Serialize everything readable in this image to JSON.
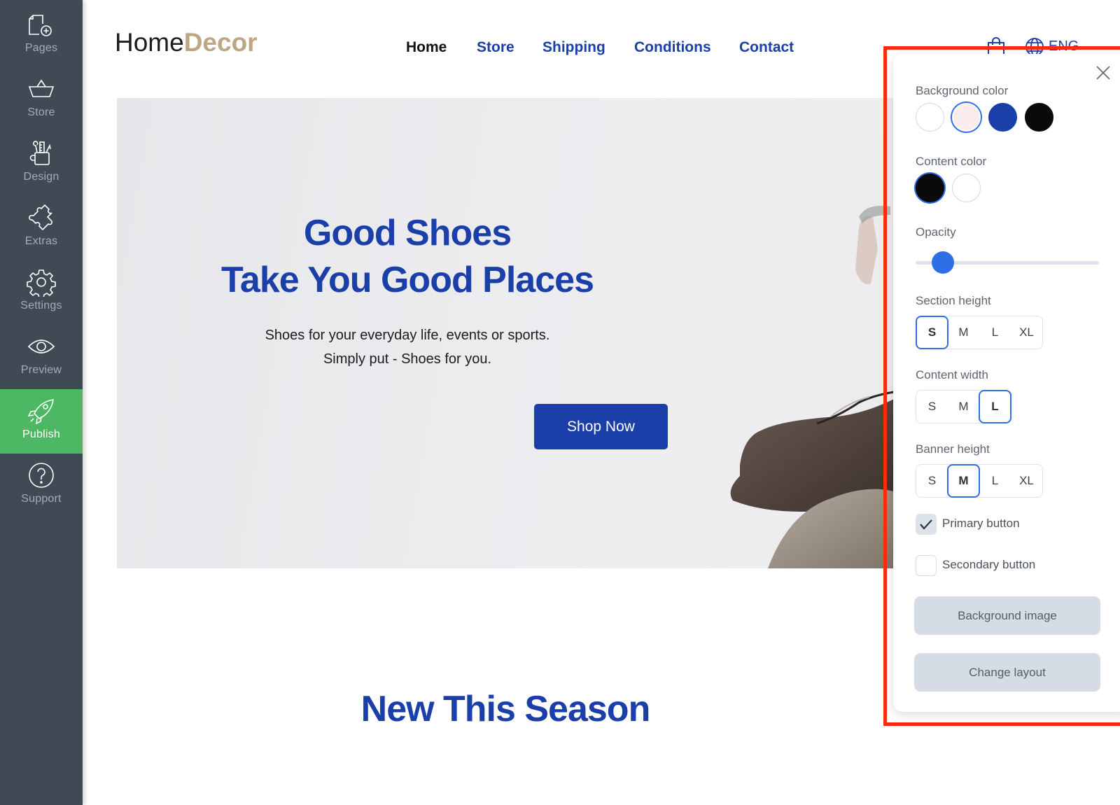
{
  "sidebar": {
    "items": [
      {
        "label": "Pages",
        "icon": "page-add-icon"
      },
      {
        "label": "Store",
        "icon": "basket-icon"
      },
      {
        "label": "Design",
        "icon": "design-tools-icon"
      },
      {
        "label": "Extras",
        "icon": "puzzle-icon"
      },
      {
        "label": "Settings",
        "icon": "gear-icon"
      },
      {
        "label": "Preview",
        "icon": "eye-icon"
      },
      {
        "label": "Publish",
        "icon": "rocket-icon",
        "active": true
      },
      {
        "label": "Support",
        "icon": "help-icon"
      }
    ]
  },
  "site": {
    "logo": {
      "part1": "Home",
      "part2": "Decor"
    },
    "nav": [
      {
        "label": "Home",
        "current": true
      },
      {
        "label": "Store"
      },
      {
        "label": "Shipping"
      },
      {
        "label": "Conditions"
      },
      {
        "label": "Contact"
      }
    ],
    "language": "ENG",
    "hero": {
      "title_line1": "Good Shoes",
      "title_line2": "Take You Good Places",
      "subtitle_line1": "Shoes for your everyday life, events or sports.",
      "subtitle_line2": "Simply put - Shoes for you.",
      "button": "Shop Now"
    },
    "section_title": "New This Season"
  },
  "panel": {
    "background_color": {
      "label": "Background color",
      "options": [
        "#ffffff",
        "#fbecec",
        "#1a3fa8",
        "#0a0a0a"
      ],
      "selected_index": 1
    },
    "content_color": {
      "label": "Content color",
      "options": [
        "#0a0a0a",
        "#ffffff"
      ],
      "selected_index": 0
    },
    "opacity": {
      "label": "Opacity",
      "value_fraction": 0.15
    },
    "section_height": {
      "label": "Section height",
      "options": [
        "S",
        "M",
        "L",
        "XL"
      ],
      "selected": "S"
    },
    "content_width": {
      "label": "Content width",
      "options": [
        "S",
        "M",
        "L"
      ],
      "selected": "L"
    },
    "banner_height": {
      "label": "Banner height",
      "options": [
        "S",
        "M",
        "L",
        "XL"
      ],
      "selected": "M"
    },
    "primary_button": {
      "label": "Primary button",
      "checked": true
    },
    "secondary_button": {
      "label": "Secondary button",
      "checked": false
    },
    "background_image_button": "Background image",
    "change_layout_button": "Change layout"
  },
  "colors": {
    "accent": "#1a3fa8",
    "logo_gold": "#bca782",
    "sidebar": "#3f4a54",
    "publish_green": "#4cb863",
    "selection_blue": "#2e6fe8",
    "highlight_red": "#fa2a10"
  }
}
